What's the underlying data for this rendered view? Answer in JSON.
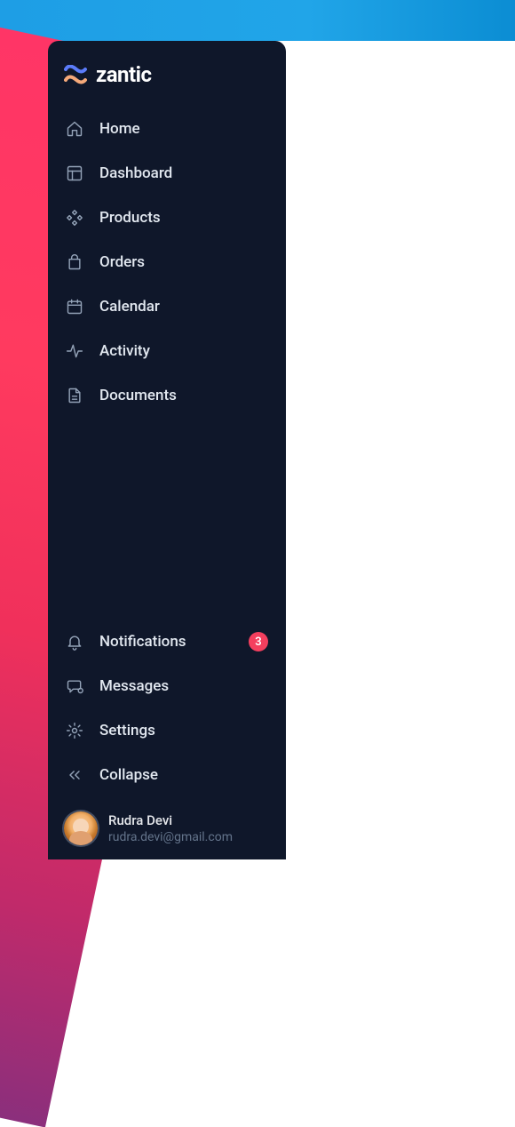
{
  "brand": {
    "name": "zantic",
    "logo_top_color": "#5b7cfa",
    "logo_bottom_color": "#f5a97a"
  },
  "nav_top": [
    {
      "key": "home",
      "icon": "home-icon",
      "label": "Home"
    },
    {
      "key": "dashboard",
      "icon": "layout-icon",
      "label": "Dashboard"
    },
    {
      "key": "products",
      "icon": "grid-dots-icon",
      "label": "Products"
    },
    {
      "key": "orders",
      "icon": "bag-icon",
      "label": "Orders"
    },
    {
      "key": "calendar",
      "icon": "calendar-icon",
      "label": "Calendar"
    },
    {
      "key": "activity",
      "icon": "activity-icon",
      "label": "Activity"
    },
    {
      "key": "documents",
      "icon": "file-icon",
      "label": "Documents"
    }
  ],
  "nav_bottom": [
    {
      "key": "notifications",
      "icon": "bell-icon",
      "label": "Notifications",
      "badge": "3"
    },
    {
      "key": "messages",
      "icon": "chat-icon",
      "label": "Messages"
    },
    {
      "key": "settings",
      "icon": "gear-icon",
      "label": "Settings"
    },
    {
      "key": "collapse",
      "icon": "chevrons-left-icon",
      "label": "Collapse"
    }
  ],
  "user": {
    "name": "Rudra Devi",
    "email": "rudra.devi@gmail.com"
  },
  "badge_bg": "#f43f5e"
}
